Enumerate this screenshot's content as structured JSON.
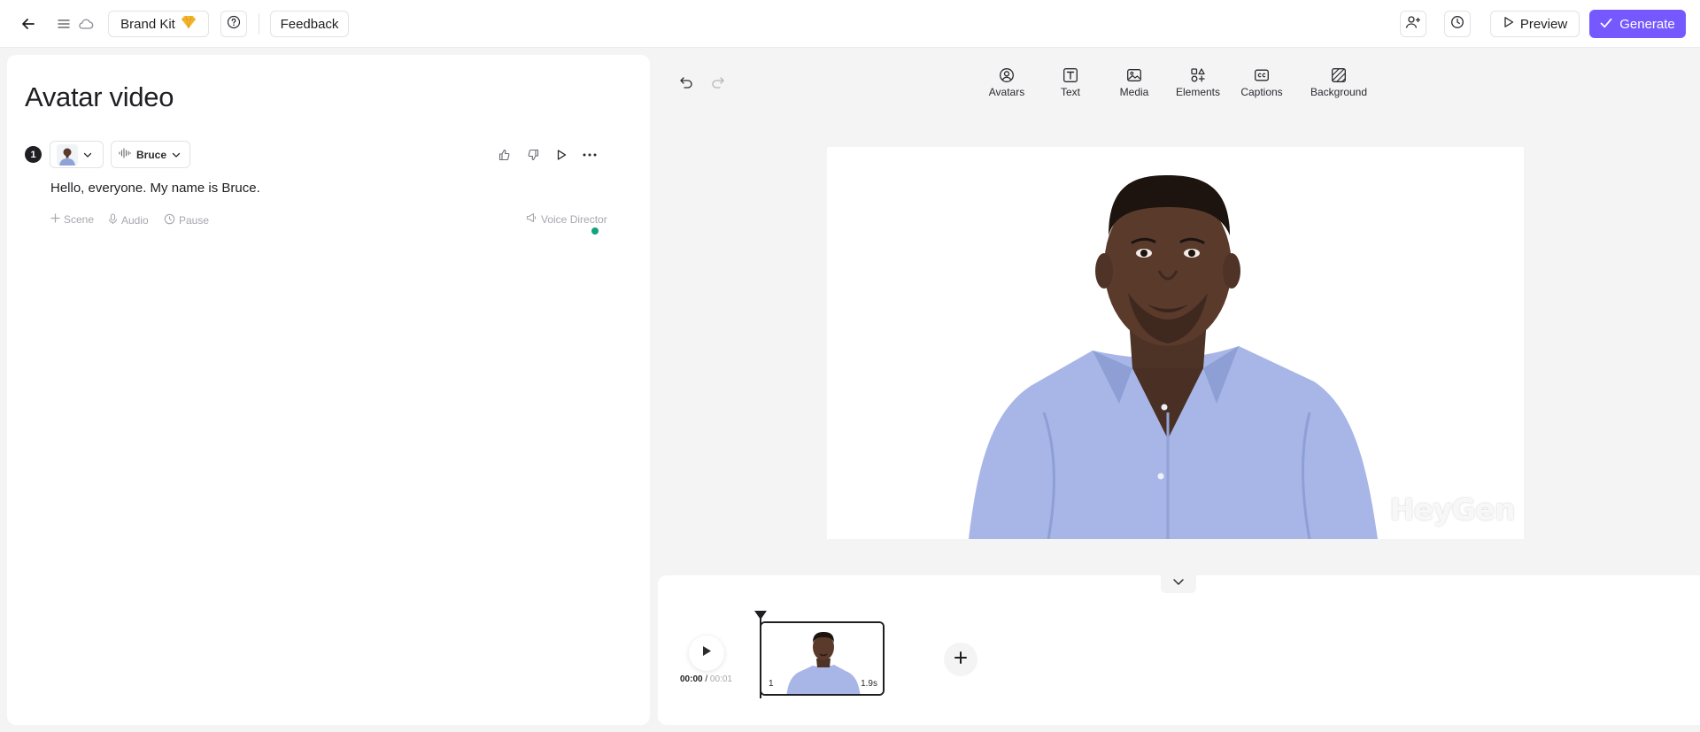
{
  "topbar": {
    "brand_kit_label": "Brand Kit",
    "feedback_label": "Feedback",
    "preview_label": "Preview",
    "generate_label": "Generate"
  },
  "editor": {
    "title": "Avatar video",
    "scene": {
      "number": "1",
      "voice_name": "Bruce",
      "script": "Hello, everyone. My name is Bruce.",
      "actions": {
        "scene": "Scene",
        "audio": "Audio",
        "pause": "Pause",
        "voice_director": "Voice Director"
      }
    }
  },
  "toolbar": {
    "tools": [
      {
        "label": "Avatars",
        "icon": "avatar-icon"
      },
      {
        "label": "Text",
        "icon": "text-icon"
      },
      {
        "label": "Media",
        "icon": "image-icon"
      },
      {
        "label": "Elements",
        "icon": "elements-icon"
      },
      {
        "label": "Captions",
        "icon": "captions-icon"
      },
      {
        "label": "Background",
        "icon": "background-icon"
      }
    ]
  },
  "canvas": {
    "watermark": "HeyGen"
  },
  "timeline": {
    "current_time": "00:00",
    "separator": " / ",
    "total_time": "00:01",
    "clips": [
      {
        "number": "1",
        "duration": "1.9s"
      }
    ]
  },
  "colors": {
    "accent": "#7559ff",
    "status_dot": "#14a37f",
    "brand_gem": "#f5b731"
  }
}
